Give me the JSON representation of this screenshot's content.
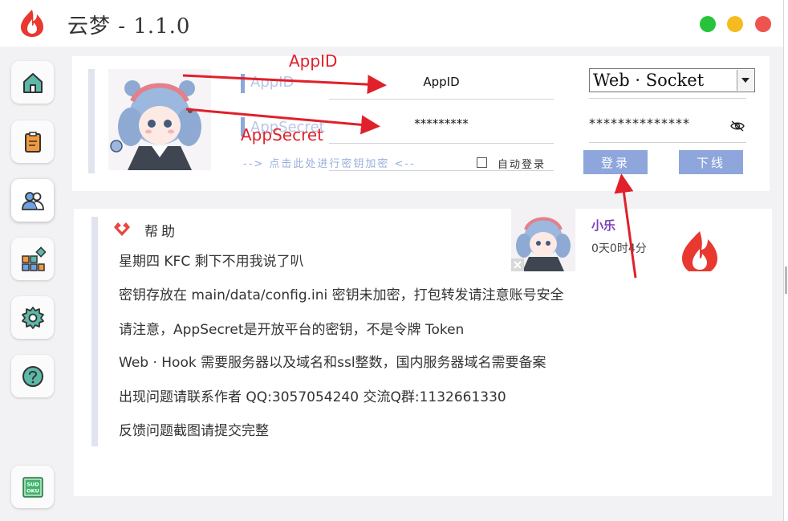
{
  "app": {
    "title": "云梦 - 1.1.0",
    "accent_color": "#8ea6dc",
    "logo_icon": "flame-logo-icon"
  },
  "window_controls": [
    {
      "name": "maximize",
      "color": "#27c33b"
    },
    {
      "name": "minimize",
      "color": "#f5bb1f"
    },
    {
      "name": "close",
      "color": "#ef5350"
    }
  ],
  "sidebar": {
    "items": [
      {
        "name": "home",
        "icon": "house-icon"
      },
      {
        "name": "notes",
        "icon": "clipboard-icon"
      },
      {
        "name": "users",
        "icon": "users-icon"
      },
      {
        "name": "apps",
        "icon": "apps-grid-icon"
      },
      {
        "name": "settings",
        "icon": "gear-icon"
      },
      {
        "name": "help",
        "icon": "question-icon"
      }
    ],
    "footer_icon": "sudoku-icon",
    "footer_text": [
      "SUD",
      "OKU"
    ]
  },
  "login": {
    "appid_label": "AppID",
    "appid_value": "AppID",
    "secret_label": "AppSecret",
    "secret_value": "*********",
    "encrypt_link": "--> 点击此处进行密钥加密 <--",
    "auto_login_label": "自动登录",
    "auto_login_checked": false,
    "connection_type": "Web · Socket",
    "secret_field_value": "**************",
    "login_button": "登录",
    "logout_button": "下线"
  },
  "help": {
    "title": "帮助",
    "lines": [
      "星期四 KFC 剩下不用我说了叭",
      "密钥存放在 main/data/config.ini 密钥未加密，打包转发请注意账号安全",
      "请注意，AppSecret是开放平台的密钥，不是令牌 Token",
      "Web · Hook 需要服务器以及域名和ssl整数，国内服务器域名需要备案",
      "出现问题请联系作者 QQ:3057054240 交流Q群:1132661330",
      "反馈问题截图请提交完整"
    ]
  },
  "user": {
    "name": "小乐",
    "uptime": "0天0时4分"
  },
  "annotations": {
    "appid": "AppID",
    "appsecret": "AppSecret",
    "color": "#e0202a"
  }
}
